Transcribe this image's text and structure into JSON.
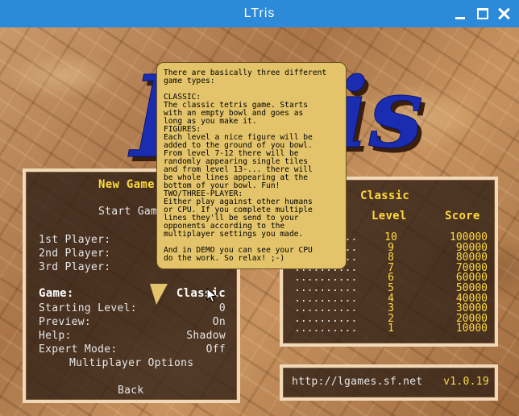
{
  "window": {
    "title": "LTris"
  },
  "logo": {
    "left": "L",
    "right": "is"
  },
  "menu": {
    "title": "New Game",
    "start_game": "Start Game",
    "players": [
      {
        "label": "1st Player:"
      },
      {
        "label": "2nd Player:"
      },
      {
        "label": "3rd Player:"
      }
    ],
    "game_label": "Game:",
    "game_value": "Classic",
    "options": [
      {
        "label": "Starting Level:",
        "value": "0"
      },
      {
        "label": "Preview:",
        "value": "On"
      },
      {
        "label": "Help:",
        "value": "Shadow"
      },
      {
        "label": "Expert Mode:",
        "value": "Off"
      }
    ],
    "multiplayer": "Multiplayer Options",
    "back": "Back"
  },
  "scores": {
    "title": "Classic",
    "level_header": "Level",
    "score_header": "Score",
    "rows": [
      {
        "name": "..........",
        "level": "10",
        "score": "100000"
      },
      {
        "name": "..........",
        "level": "9",
        "score": "90000"
      },
      {
        "name": "..........",
        "level": "8",
        "score": "80000"
      },
      {
        "name": "..........",
        "level": "7",
        "score": "70000"
      },
      {
        "name": "..........",
        "level": "6",
        "score": "60000"
      },
      {
        "name": "..........",
        "level": "5",
        "score": "50000"
      },
      {
        "name": "..........",
        "level": "4",
        "score": "40000"
      },
      {
        "name": "..........",
        "level": "3",
        "score": "30000"
      },
      {
        "name": "..........",
        "level": "2",
        "score": "20000"
      },
      {
        "name": "..........",
        "level": "1",
        "score": "10000"
      }
    ]
  },
  "footer": {
    "url": "http://lgames.sf.net",
    "version": "v1.0.19"
  },
  "tooltip": {
    "text": "There are basically three different\ngame types:\n\nCLASSIC:\nThe classic tetris game. Starts\nwith an empty bowl and goes as\nlong as you make it.\nFIGURES:\nEach level a nice figure will be\nadded to the ground of you bowl.\nFrom level 7-12 there will be\nrandomly appearing single tiles\nand from level 13-... there will\nbe whole lines appearing at the\nbottom of your bowl. Fun!\nTWO/THREE-PLAYER:\nEither play against other humans\nor CPU. If you complete multiple\nlines they'll be send to your\nopponents according to the\nmultiplayer settings you made.\n\nAnd in DEMO you can see your CPU\ndo the work. So relax! ;-)"
  },
  "colors": {
    "titlebar": "#2d8ad8",
    "menu_highlight": "#ffdb3f",
    "logo": "#1a2db0",
    "tooltip_bg": "#e3c46a"
  }
}
